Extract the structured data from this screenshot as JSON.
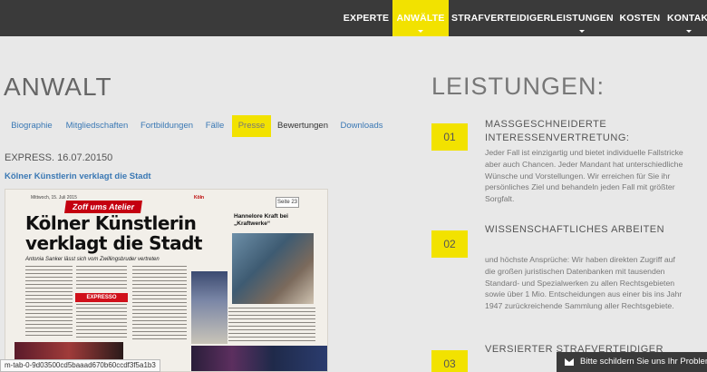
{
  "nav": {
    "items": [
      {
        "label": "EXPERTE",
        "dropdown": false,
        "active": false
      },
      {
        "label": "ANWÄLTE",
        "dropdown": true,
        "active": true
      },
      {
        "label": "STRAFVERTEIDIGER",
        "dropdown": false,
        "active": false
      },
      {
        "label": "LEISTUNGEN",
        "dropdown": true,
        "active": false
      },
      {
        "label": "KOSTEN",
        "dropdown": false,
        "active": false
      },
      {
        "label": "KONTAKT",
        "dropdown": true,
        "active": false
      }
    ]
  },
  "main": {
    "title": "ANWALT",
    "tabs": [
      {
        "label": "Biographie",
        "active": false
      },
      {
        "label": "Mitgliedschaften",
        "active": false
      },
      {
        "label": "Fortbildungen",
        "active": false
      },
      {
        "label": "Fälle",
        "active": false
      },
      {
        "label": "Presse",
        "active": true
      },
      {
        "label": "Bewertungen",
        "active": false
      },
      {
        "label": "Downloads",
        "active": false
      }
    ],
    "meta": "EXPRESS. 16.07.20150",
    "article_link": "Kölner Künstlerin verklagt die Stadt",
    "clipping": {
      "date": "Mittwoch, 15. Juli 2015",
      "section": "Köln",
      "page": "Seite 23",
      "banner": "Zoff ums Atelier",
      "headline": "Kölner Künstlerin verklagt die Stadt",
      "subline": "Antonia Sanker lässt sich vom Zwillingsbruder vertreten",
      "side_headline": "Hannelore Kraft bei „Kraftwerke“",
      "expresso": "EXPRESSO"
    }
  },
  "status_url": "m-tab-0-9d03500cd5baaad670b60ccdf3f5a1b3",
  "services": {
    "title": "LEISTUNGEN:",
    "items": [
      {
        "num": "01",
        "title": "MASSGESCHNEIDERTE INTERESSENVERTRETUNG:",
        "desc": "Jeder Fall ist einzigartig und bietet individuelle Fallstricke aber auch Chancen. Jeder Mandant hat unterschiedliche Wünsche und Vorstellungen. Wir erreichen für Sie ihr persönliches Ziel und behandeln jeden Fall mit größter Sorgfalt."
      },
      {
        "num": "02",
        "title": "WISSENSCHAFTLICHES ARBEITEN",
        "desc": "und höchste Ansprüche: Wir haben direkten Zugriff auf die großen juristischen Datenbanken mit tausenden Standard- und Spezialwerken zu allen Rechtsgebieten sowie über 1 Mio. Entscheidungen aus einer bis ins Jahr 1947 zurückreichende Sammlung aller Rechtsgebiete."
      },
      {
        "num": "03",
        "title": "VERSIERTER STRAFVERTEIDIGER",
        "desc": ""
      }
    ]
  },
  "chat": {
    "label": "Bitte schildern Sie uns Ihr Problem!",
    "icon": "mail-icon"
  },
  "colors": {
    "accent": "#f2e200",
    "nav_bg": "#3a3a3a",
    "link": "#3a78b4",
    "page_bg": "#e8e8e8"
  }
}
